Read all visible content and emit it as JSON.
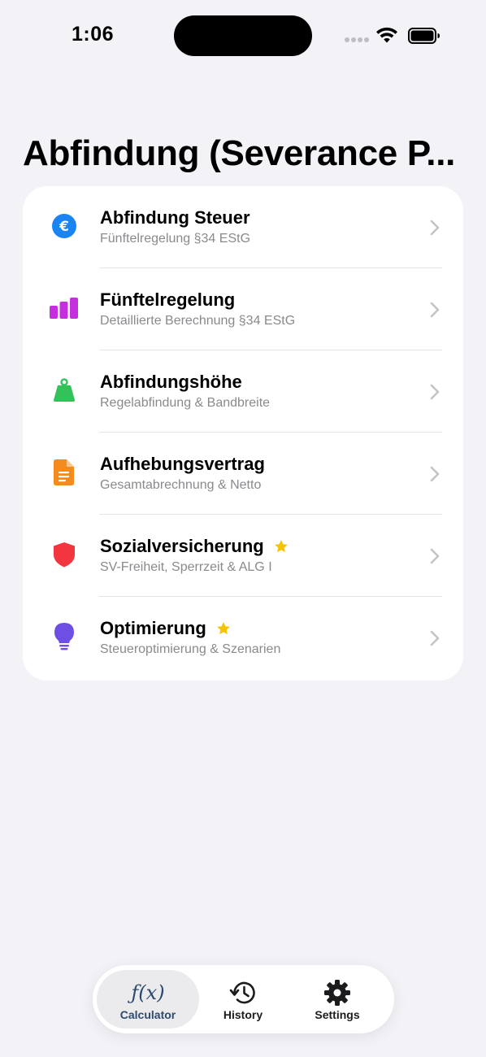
{
  "status_bar": {
    "time": "1:06"
  },
  "page": {
    "title": "Abfindung (Severance P..."
  },
  "list": [
    {
      "title": "Abfindung Steuer",
      "subtitle": "Fünftelregelung §34 EStG",
      "icon": "euro-icon",
      "color": "#1a84f3",
      "starred": false
    },
    {
      "title": "Fünftelregelung",
      "subtitle": "Detaillierte Berechnung §34 EStG",
      "icon": "bar-chart-icon",
      "color": "#c62fe0",
      "starred": false
    },
    {
      "title": "Abfindungshöhe",
      "subtitle": "Regelabfindung & Bandbreite",
      "icon": "weight-icon",
      "color": "#33c15a",
      "starred": false
    },
    {
      "title": "Aufhebungsvertrag",
      "subtitle": "Gesamtabrechnung & Netto",
      "icon": "document-icon",
      "color": "#f58a1f",
      "starred": false
    },
    {
      "title": "Sozialversicherung",
      "subtitle": "SV-Freiheit, Sperrzeit & ALG I",
      "icon": "shield-icon",
      "color": "#f2353f",
      "starred": true
    },
    {
      "title": "Optimierung",
      "subtitle": "Steueroptimierung & Szenarien",
      "icon": "lightbulb-icon",
      "color": "#6f4ee6",
      "starred": true
    }
  ],
  "colors": {
    "star": "#f5c400",
    "chevron": "#c4c4c8",
    "tab_selected": "#2c4a6e"
  },
  "tabbar": {
    "tabs": [
      {
        "label": "Calculator",
        "icon": "function-icon",
        "glyph": "ƒ(x)",
        "selected": true
      },
      {
        "label": "History",
        "icon": "history-icon",
        "selected": false
      },
      {
        "label": "Settings",
        "icon": "gear-icon",
        "selected": false
      }
    ]
  }
}
